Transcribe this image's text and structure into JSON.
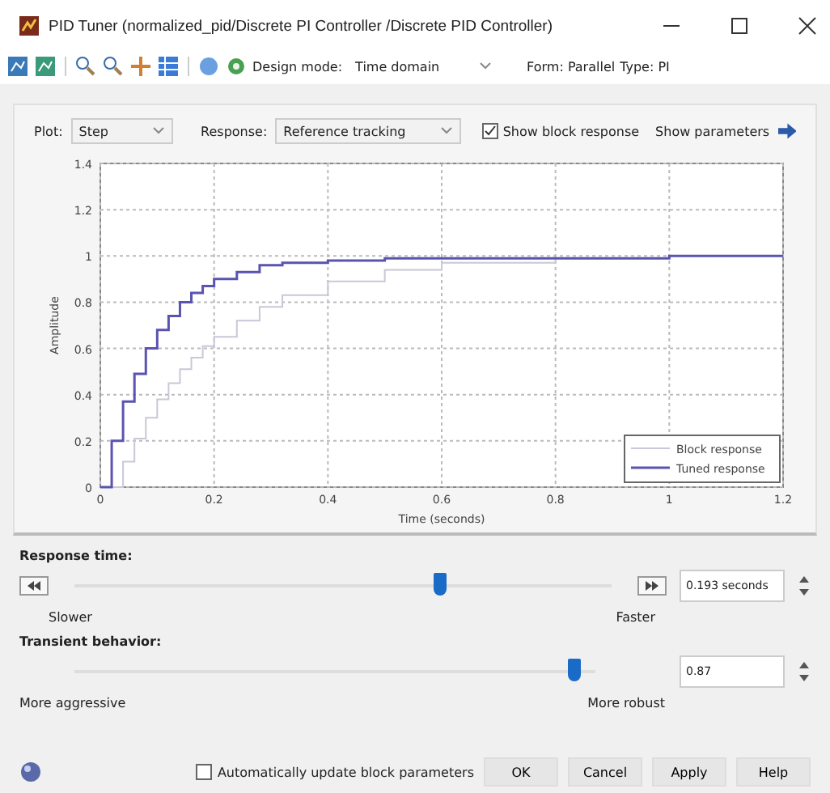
{
  "window": {
    "title": "PID Tuner (normalized_pid/Discrete PI Controller /Discrete PID Controller)"
  },
  "toolbar": {
    "design_mode_label": "Design mode:",
    "design_mode": "Time domain",
    "form": "Form: Parallel",
    "type": "Type: PI"
  },
  "plot_controls": {
    "plot_label": "Plot:",
    "plot": "Step",
    "response_label": "Response:",
    "response": "Reference tracking",
    "show_block_response": {
      "label": "Show block response",
      "checked": true
    },
    "show_parameters": "Show parameters"
  },
  "chart_data": {
    "type": "line",
    "xlabel": "Time (seconds)",
    "ylabel": "Amplitude",
    "grid": true,
    "legend": true,
    "x": [
      0,
      0.02,
      0.02,
      0.04,
      0.04,
      0.06,
      0.06,
      0.08,
      0.08,
      0.1,
      0.1,
      0.12,
      0.12,
      0.14,
      0.14,
      0.16,
      0.16,
      0.18,
      0.18,
      0.2,
      0.2,
      0.24,
      0.24,
      0.28,
      0.28,
      0.32,
      0.32,
      0.4,
      0.4,
      0.5,
      0.5,
      0.6,
      0.6,
      0.8,
      0.8,
      1,
      1,
      1.2
    ],
    "series": [
      {
        "name": "Block response",
        "color": "#c8c8d8",
        "values": [
          0,
          0,
          0,
          0,
          0.11,
          0.11,
          0.21,
          0.21,
          0.3,
          0.3,
          0.38,
          0.38,
          0.45,
          0.45,
          0.51,
          0.51,
          0.56,
          0.56,
          0.61,
          0.61,
          0.65,
          0.65,
          0.72,
          0.72,
          0.78,
          0.78,
          0.83,
          0.83,
          0.89,
          0.89,
          0.94,
          0.94,
          0.97,
          0.97,
          0.99,
          0.99,
          1,
          1
        ]
      },
      {
        "name": "Tuned response",
        "color": "#5a54b0",
        "values": [
          0,
          0,
          0.2,
          0.2,
          0.37,
          0.37,
          0.49,
          0.49,
          0.6,
          0.6,
          0.68,
          0.68,
          0.74,
          0.74,
          0.8,
          0.8,
          0.84,
          0.84,
          0.87,
          0.87,
          0.9,
          0.9,
          0.93,
          0.93,
          0.96,
          0.96,
          0.97,
          0.97,
          0.98,
          0.98,
          0.99,
          0.99,
          0.99,
          0.99,
          0.99,
          0.99,
          1,
          1
        ]
      }
    ],
    "xlim": [
      0,
      1.2
    ],
    "ylim": [
      0,
      1.4
    ],
    "xticks": [
      0,
      0.2,
      0.4,
      0.6,
      0.8,
      1,
      1.2
    ],
    "yticks": [
      0,
      0.2,
      0.4,
      0.6,
      0.8,
      1,
      1.2,
      1.4
    ]
  },
  "response_time": {
    "title": "Response time:",
    "level": 0.68,
    "left": "Slower",
    "right": "Faster",
    "value": "0.193 seconds"
  },
  "transient": {
    "title": "Transient behavior:",
    "level": 0.96,
    "left": "More aggressive",
    "right": "More robust",
    "value": "0.87"
  },
  "footer": {
    "auto_update": {
      "label": "Automatically update block parameters",
      "checked": false
    },
    "buttons": [
      "OK",
      "Cancel",
      "Apply",
      "Help"
    ]
  }
}
